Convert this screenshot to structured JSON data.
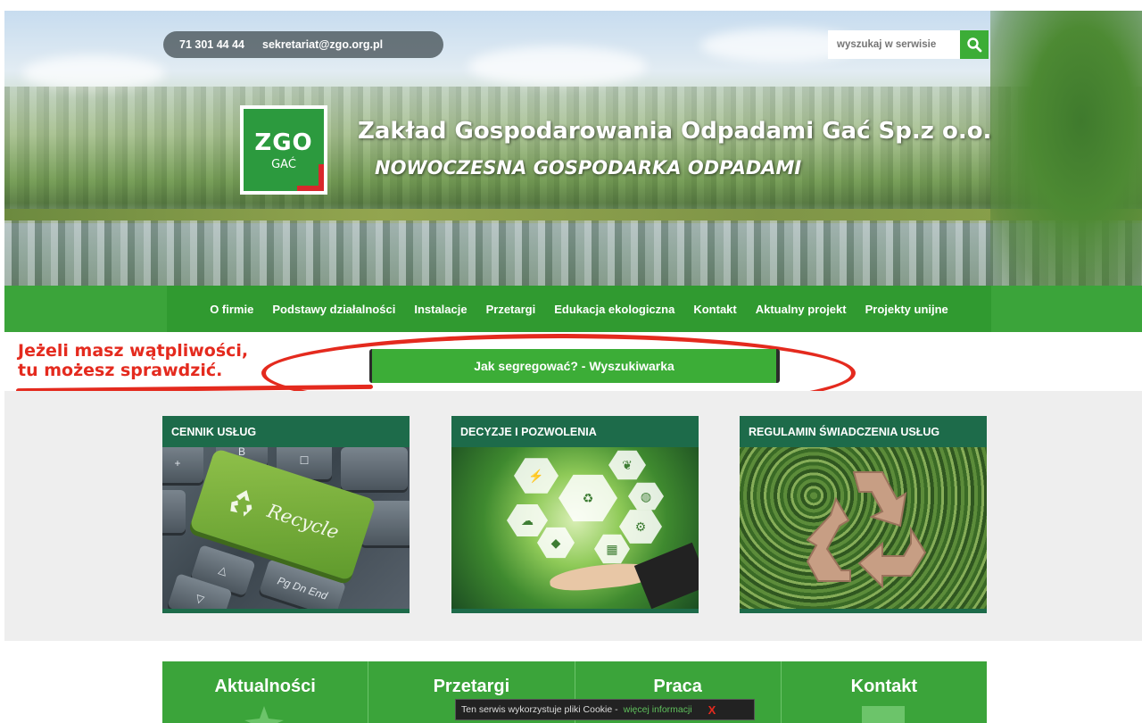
{
  "header": {
    "phone": "71 301 44 44",
    "email": "sekretariat@zgo.org.pl",
    "search_placeholder": "wyszukaj w serwisie",
    "logo_main": "ZGO",
    "logo_sub": "GAĆ",
    "site_title": "Zakład Gospodarowania Odpadami Gać Sp.z o.o.",
    "slogan": "NOWOCZESNA GOSPODARKA ODPADAMI"
  },
  "nav": {
    "items": [
      {
        "label": "O firmie"
      },
      {
        "label": "Podstawy działalności"
      },
      {
        "label": "Instalacje"
      },
      {
        "label": "Przetargi"
      },
      {
        "label": "Edukacja ekologiczna"
      },
      {
        "label": "Kontakt"
      },
      {
        "label": "Aktualny projekt"
      },
      {
        "label": "Projekty unijne"
      }
    ]
  },
  "annotation": {
    "line1": "Jeżeli masz wątpliwości,",
    "line2": "tu możesz sprawdzić.",
    "button_label": "Jak segregować? - Wyszukiwarka"
  },
  "cards": [
    {
      "title": "CENNIK USŁUG",
      "key_label": "Recycle",
      "keys": [
        "+",
        "B",
        "☐",
        "△",
        "▽",
        "Pg Dn End"
      ]
    },
    {
      "title": "DECYZJE I POZWOLENIA"
    },
    {
      "title": "REGULAMIN ŚWIADCZENIA USŁUG"
    }
  ],
  "tiles": [
    {
      "label": "Aktualności"
    },
    {
      "label": "Przetargi"
    },
    {
      "label": "Praca"
    },
    {
      "label": "Kontakt"
    }
  ],
  "cookie": {
    "text": "Ten serwis wykorzystuje pliki Cookie -",
    "link": "więcej informacji",
    "close": "X"
  },
  "colors": {
    "brand_green": "#3ba43a",
    "card_header": "#1d6b4a",
    "annotation_red": "#e42a1e"
  }
}
